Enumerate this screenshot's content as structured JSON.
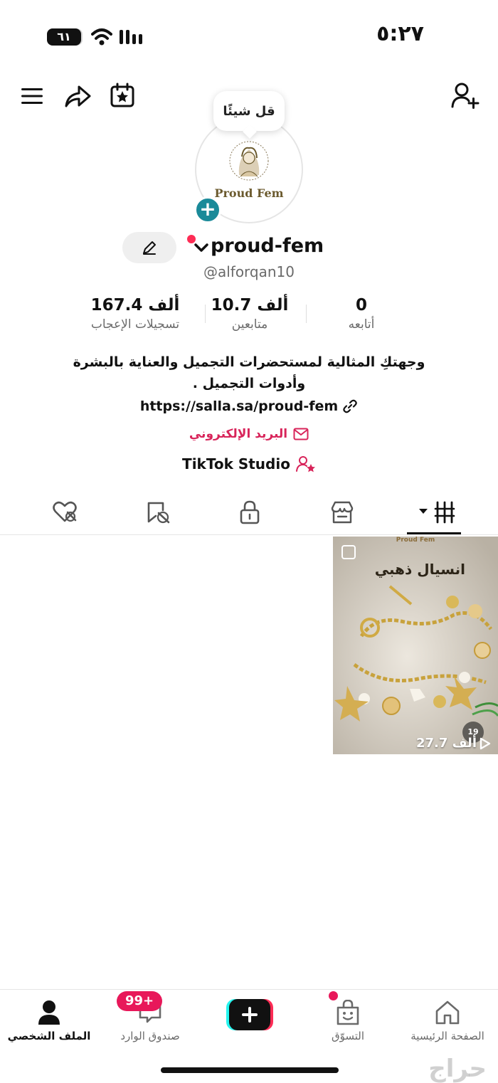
{
  "status_bar": {
    "time": "٥:٢٧",
    "battery": "٦١"
  },
  "profile": {
    "bubble_text": "قل شيئًا",
    "logo_text": "Proud Fem",
    "username": "proud-fem",
    "handle": "@alforqan10"
  },
  "stats": {
    "following": {
      "value": "0",
      "label": "أتابعه"
    },
    "followers": {
      "value": "10.7 ألف",
      "label": "متابعين"
    },
    "likes": {
      "value": "167.4 ألف",
      "label": "تسجيلات الإعجاب"
    }
  },
  "bio": {
    "text": "وجهتكِ المثالية لمستحضرات التجميل والعناية بالبشرة وأدوات التجميل .",
    "link": "https://salla.sa/proud-fem",
    "email_label": "البريد الإلكتروني",
    "studio_label": "TikTok Studio"
  },
  "tabs": [
    "videos-icon",
    "shop-icon",
    "lock-icon",
    "tagged-icon",
    "liked-icon"
  ],
  "video": {
    "brand": "Proud Fem",
    "title": "انسيال ذهبي",
    "price": "19",
    "views": "27.7 ألف"
  },
  "nav": {
    "home": "الصفحة الرئيسية",
    "shop": "التسوّق",
    "inbox": "صندوق الوارد",
    "profile": "الملف الشخصي",
    "inbox_badge": "99+"
  },
  "watermark": "حراج",
  "colors": {
    "accent_pink": "#fe2c55",
    "teal": "#1a8a99",
    "email_pink": "#d8245a"
  }
}
